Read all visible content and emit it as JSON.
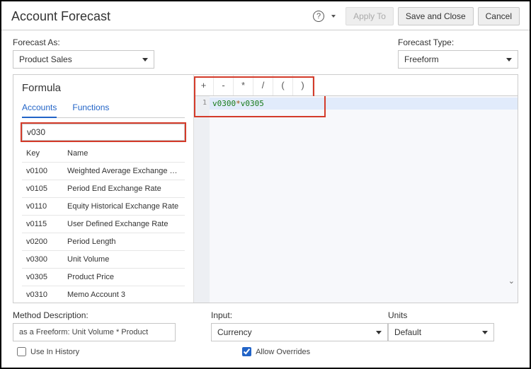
{
  "header": {
    "title": "Account Forecast",
    "help_glyph": "?",
    "buttons": {
      "apply_to": "Apply To",
      "save_close": "Save and Close",
      "cancel": "Cancel"
    }
  },
  "top": {
    "forecast_as_label": "Forecast As:",
    "forecast_as_value": "Product Sales",
    "forecast_type_label": "Forecast Type:",
    "forecast_type_value": "Freeform"
  },
  "formula": {
    "title": "Formula",
    "tabs": [
      "Accounts",
      "Functions"
    ],
    "search_value": "v030",
    "columns": {
      "key": "Key",
      "name": "Name"
    },
    "rows": [
      {
        "key": "v0100",
        "name": "Weighted Average Exchange Rate"
      },
      {
        "key": "v0105",
        "name": "Period End Exchange Rate"
      },
      {
        "key": "v0110",
        "name": "Equity Historical Exchange Rate"
      },
      {
        "key": "v0115",
        "name": "User Defined Exchange Rate"
      },
      {
        "key": "v0200",
        "name": "Period Length"
      },
      {
        "key": "v0300",
        "name": "Unit Volume"
      },
      {
        "key": "v0305",
        "name": "Product Price"
      },
      {
        "key": "v0310",
        "name": "Memo Account 3"
      }
    ]
  },
  "editor": {
    "ops": [
      "+",
      "-",
      "*",
      "/",
      "(",
      ")"
    ],
    "line_no": "1",
    "token_a": "v0300",
    "token_op": "*",
    "token_b": "v0305"
  },
  "bottom": {
    "method_label": "Method Description:",
    "method_value": "as a Freeform:  Unit Volume * Product",
    "input_label": "Input:",
    "input_value": "Currency",
    "units_label": "Units",
    "units_value": "Default",
    "use_history_label": "Use In History",
    "allow_overrides_label": "Allow Overrides"
  }
}
